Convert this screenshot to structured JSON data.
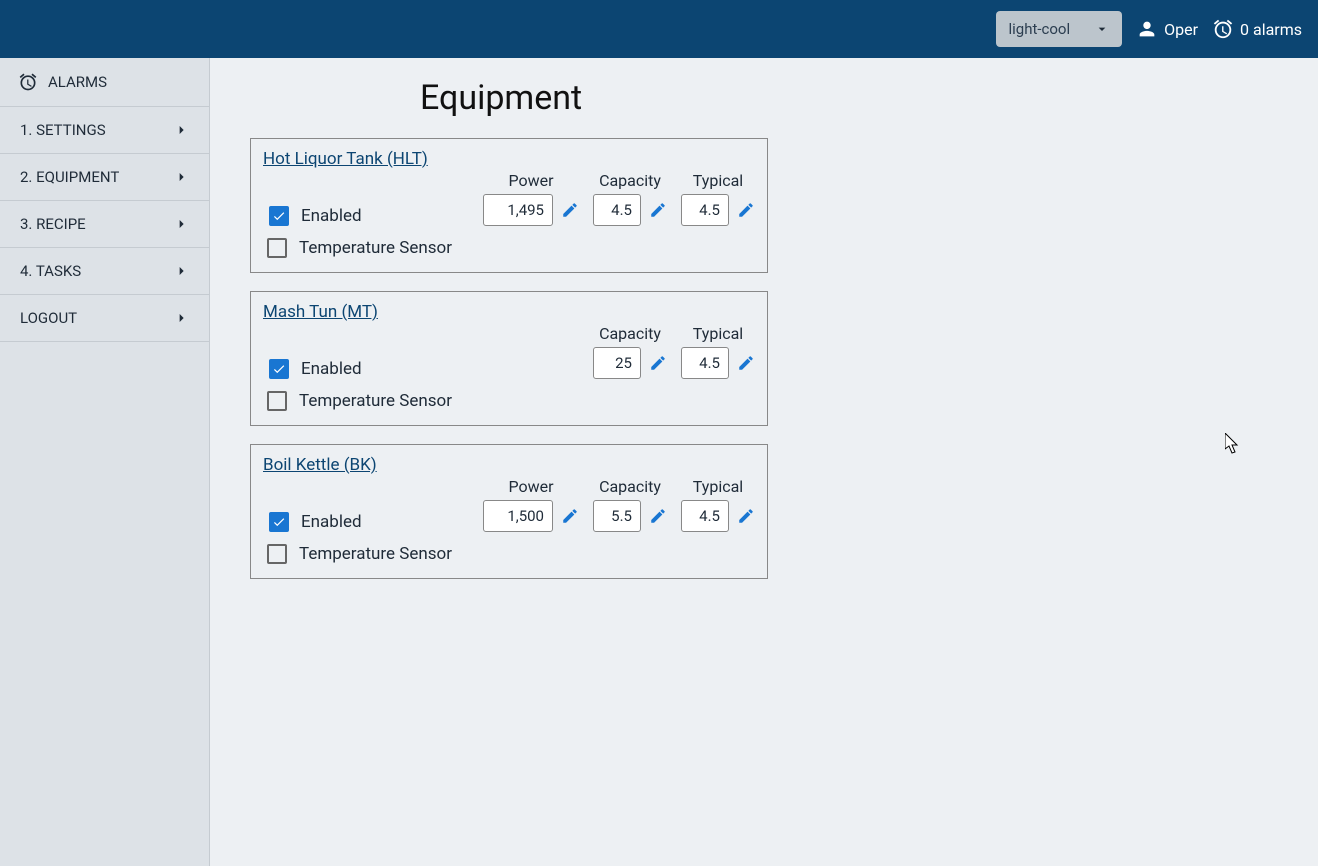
{
  "header": {
    "theme_value": "light-cool",
    "user_label": "Oper",
    "alarms_label": "0 alarms"
  },
  "sidebar": {
    "alarms_label": "ALARMS",
    "items": [
      {
        "label": "1. SETTINGS"
      },
      {
        "label": "2. EQUIPMENT"
      },
      {
        "label": "3. RECIPE"
      },
      {
        "label": "4. TASKS"
      },
      {
        "label": "LOGOUT"
      }
    ]
  },
  "page_title": "Equipment",
  "enabled_label": "Enabled",
  "sensor_label": "Temperature Sensor",
  "field_labels": {
    "power": "Power",
    "capacity": "Capacity",
    "typical": "Typical"
  },
  "equipment": [
    {
      "title": "Hot Liquor Tank (HLT)",
      "enabled": true,
      "sensor": false,
      "power": "1,495",
      "capacity": "4.5",
      "typical": "4.5"
    },
    {
      "title": "Mash Tun (MT)",
      "enabled": true,
      "sensor": false,
      "power": null,
      "capacity": "25",
      "typical": "4.5"
    },
    {
      "title": "Boil Kettle (BK)",
      "enabled": true,
      "sensor": false,
      "power": "1,500",
      "capacity": "5.5",
      "typical": "4.5"
    }
  ]
}
